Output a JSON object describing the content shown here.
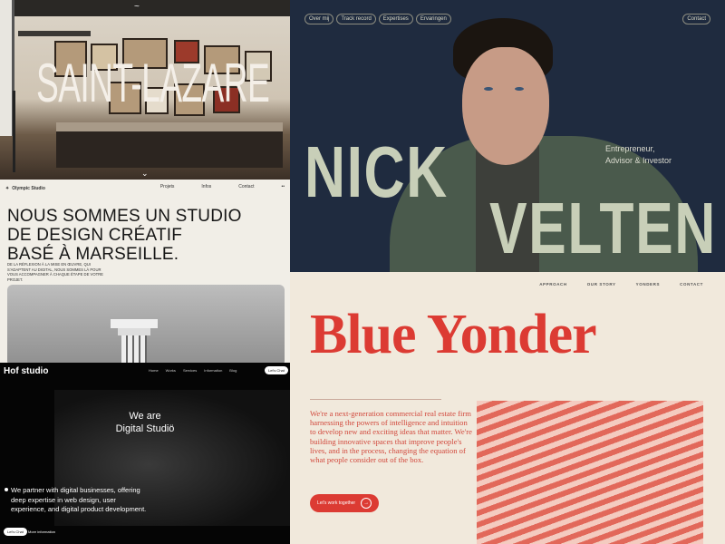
{
  "saint_lazare": {
    "title": "SAINT-LAZARE",
    "logo": "~",
    "scroll": "⌄"
  },
  "nick": {
    "nav": [
      "Over mij",
      "Track record",
      "Expertises",
      "Ervaringen"
    ],
    "contact": "Contact",
    "first": "NICK",
    "last": "VELTEN",
    "role1": "Entrepreneur,",
    "role2": "Advisor & Investor"
  },
  "olympic": {
    "brand": "Olympic Studio",
    "nav": [
      "Projets",
      "Infos",
      "Contact"
    ],
    "headline1": "NOUS SOMMES UN STUDIO",
    "headline2": "DE DESIGN CRÉATIF",
    "headline3": "BASÉ À MARSEILLE.",
    "body": "DE LA RÉFLEXION À LA MISE EN ŒUVRE, QUI S'ADAPTENT AU DIGITAL, NOUS SOMMES LÀ POUR VOUS ACCOMPAGNER À CHAQUE ÉTAPE DE VOTRE PROJET."
  },
  "hof": {
    "logo": "Hof studio",
    "nav": [
      "Home",
      "Works",
      "Services",
      "Information",
      "Blog"
    ],
    "cta": "Let's Chat",
    "hero1": "We are",
    "hero2": "Digital Studiö",
    "desc": "We partner with digital businesses, offering deep expertise in web design, user experience, and digital product development.",
    "lets": "Let's Chat",
    "more": "More information"
  },
  "blue": {
    "nav": [
      "APPROACH",
      "OUR STORY",
      "YONDERS",
      "CONTACT"
    ],
    "title": "Blue Yonder",
    "text": "We're a next-generation commercial real estate firm harnessing the powers of intelligence and intuition to develop new and exciting ideas that matter. We're building innovative spaces that improve people's lives, and in the process, changing the equation of what people consider out of the box.",
    "cta": "Let's work together",
    "arrow": "→"
  }
}
